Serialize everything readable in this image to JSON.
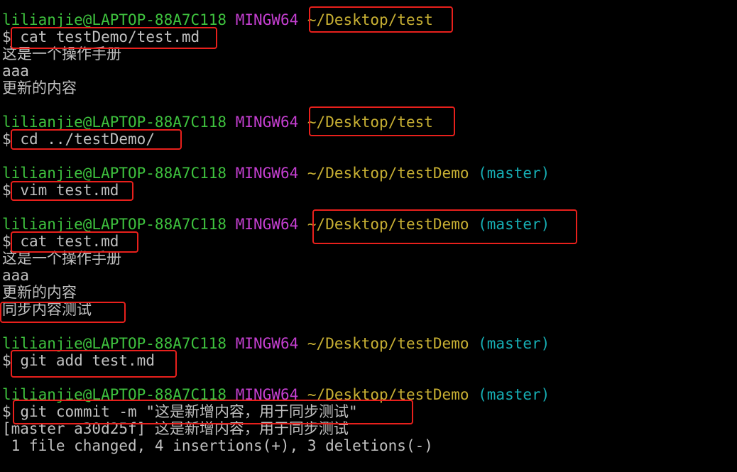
{
  "colors": {
    "background": "#000000",
    "text": "#c0c0c0",
    "user_host": "#3ec23e",
    "msystem": "#c53fd1",
    "path": "#c8b033",
    "branch": "#16aeb4",
    "highlight_box": "#e8201c"
  },
  "prompt": {
    "user_host": "lilianjie@LAPTOP-88A7C118",
    "msystem": "MINGW64",
    "dollar": "$"
  },
  "blocks": [
    {
      "path": "~/Desktop/test",
      "branch": "",
      "command": "cat testDemo/test.md",
      "output": [
        "这是一个操作手册",
        "aaa",
        "更新的内容"
      ]
    },
    {
      "path": "~/Desktop/test",
      "branch": "",
      "command": "cd ../testDemo/",
      "output": []
    },
    {
      "path": "~/Desktop/testDemo",
      "branch": "(master)",
      "command": "vim test.md",
      "output": []
    },
    {
      "path": "~/Desktop/testDemo",
      "branch": "(master)",
      "command": "cat test.md",
      "output": [
        "这是一个操作手册",
        "aaa",
        "更新的内容",
        "同步内容测试"
      ]
    },
    {
      "path": "~/Desktop/testDemo",
      "branch": "(master)",
      "command": "git add test.md",
      "output": []
    },
    {
      "path": "~/Desktop/testDemo",
      "branch": "(master)",
      "command": "git commit -m \"这是新增内容，用于同步测试\"",
      "output": [
        "[master a30d25f] 这是新增内容，用于同步测试",
        " 1 file changed, 4 insertions(+), 3 deletions(-)"
      ]
    }
  ]
}
